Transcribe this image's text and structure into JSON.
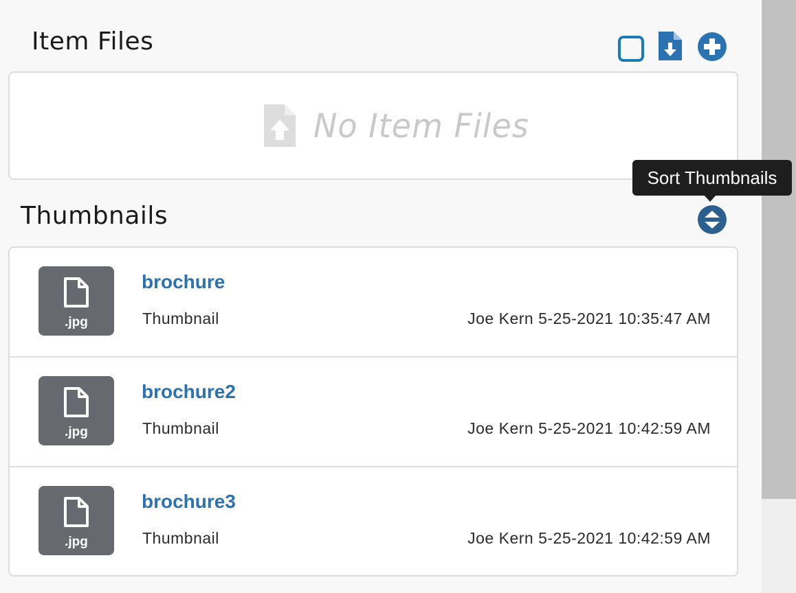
{
  "item_files": {
    "title": "Item Files",
    "empty_text": "No Item Files",
    "toolbar": {
      "select_icon": "checkbox-square-icon",
      "download_icon": "file-download-icon",
      "add_icon": "plus-circle-icon"
    }
  },
  "thumbnails": {
    "title": "Thumbnails",
    "sort_tooltip": "Sort Thumbnails",
    "sort_icon": "sort-icon",
    "items": [
      {
        "name": "brochure",
        "ext": ".jpg",
        "type": "Thumbnail",
        "meta": "Joe Kern 5-25-2021 10:35:47 AM"
      },
      {
        "name": "brochure2",
        "ext": ".jpg",
        "type": "Thumbnail",
        "meta": "Joe Kern 5-25-2021 10:42:59 AM"
      },
      {
        "name": "brochure3",
        "ext": ".jpg",
        "type": "Thumbnail",
        "meta": "Joe Kern 5-25-2021 10:42:59 AM"
      }
    ]
  },
  "colors": {
    "accent": "#2b72b2",
    "thumb_bg": "#666a6e",
    "tooltip_bg": "#1e1e1e",
    "empty_text": "#c9c9c9"
  }
}
